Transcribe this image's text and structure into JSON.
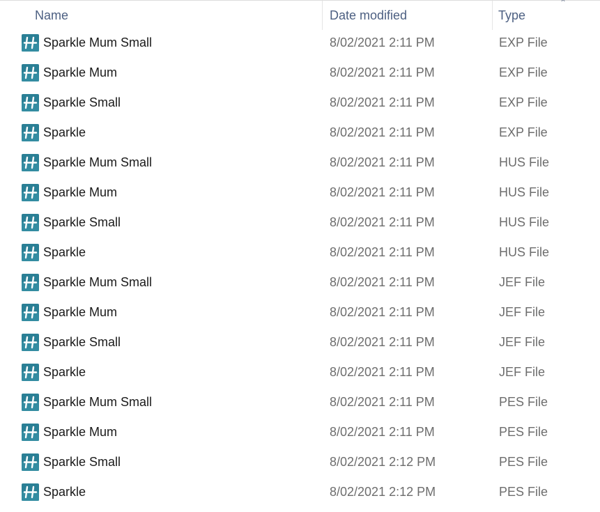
{
  "columns": {
    "name": "Name",
    "date_modified": "Date modified",
    "type": "Type"
  },
  "sort_icon": "chevron-up-icon",
  "file_icon": "hus-embroidery-icon",
  "colors": {
    "header_text": "#4d6082",
    "icon_bg": "#2a7f95",
    "secondary_text": "#6d6d6d"
  },
  "files": [
    {
      "name": "Sparkle Mum Small",
      "date": "8/02/2021 2:11 PM",
      "type": "EXP File"
    },
    {
      "name": "Sparkle Mum",
      "date": "8/02/2021 2:11 PM",
      "type": "EXP File"
    },
    {
      "name": "Sparkle Small",
      "date": "8/02/2021 2:11 PM",
      "type": "EXP File"
    },
    {
      "name": "Sparkle",
      "date": "8/02/2021 2:11 PM",
      "type": "EXP File"
    },
    {
      "name": "Sparkle Mum Small",
      "date": "8/02/2021 2:11 PM",
      "type": "HUS File"
    },
    {
      "name": "Sparkle Mum",
      "date": "8/02/2021 2:11 PM",
      "type": "HUS File"
    },
    {
      "name": "Sparkle Small",
      "date": "8/02/2021 2:11 PM",
      "type": "HUS File"
    },
    {
      "name": "Sparkle",
      "date": "8/02/2021 2:11 PM",
      "type": "HUS File"
    },
    {
      "name": "Sparkle Mum Small",
      "date": "8/02/2021 2:11 PM",
      "type": "JEF File"
    },
    {
      "name": "Sparkle Mum",
      "date": "8/02/2021 2:11 PM",
      "type": "JEF File"
    },
    {
      "name": "Sparkle Small",
      "date": "8/02/2021 2:11 PM",
      "type": "JEF File"
    },
    {
      "name": "Sparkle",
      "date": "8/02/2021 2:11 PM",
      "type": "JEF File"
    },
    {
      "name": "Sparkle Mum Small",
      "date": "8/02/2021 2:11 PM",
      "type": "PES File"
    },
    {
      "name": "Sparkle Mum",
      "date": "8/02/2021 2:11 PM",
      "type": "PES File"
    },
    {
      "name": "Sparkle Small",
      "date": "8/02/2021 2:12 PM",
      "type": "PES File"
    },
    {
      "name": "Sparkle",
      "date": "8/02/2021 2:12 PM",
      "type": "PES File"
    }
  ]
}
